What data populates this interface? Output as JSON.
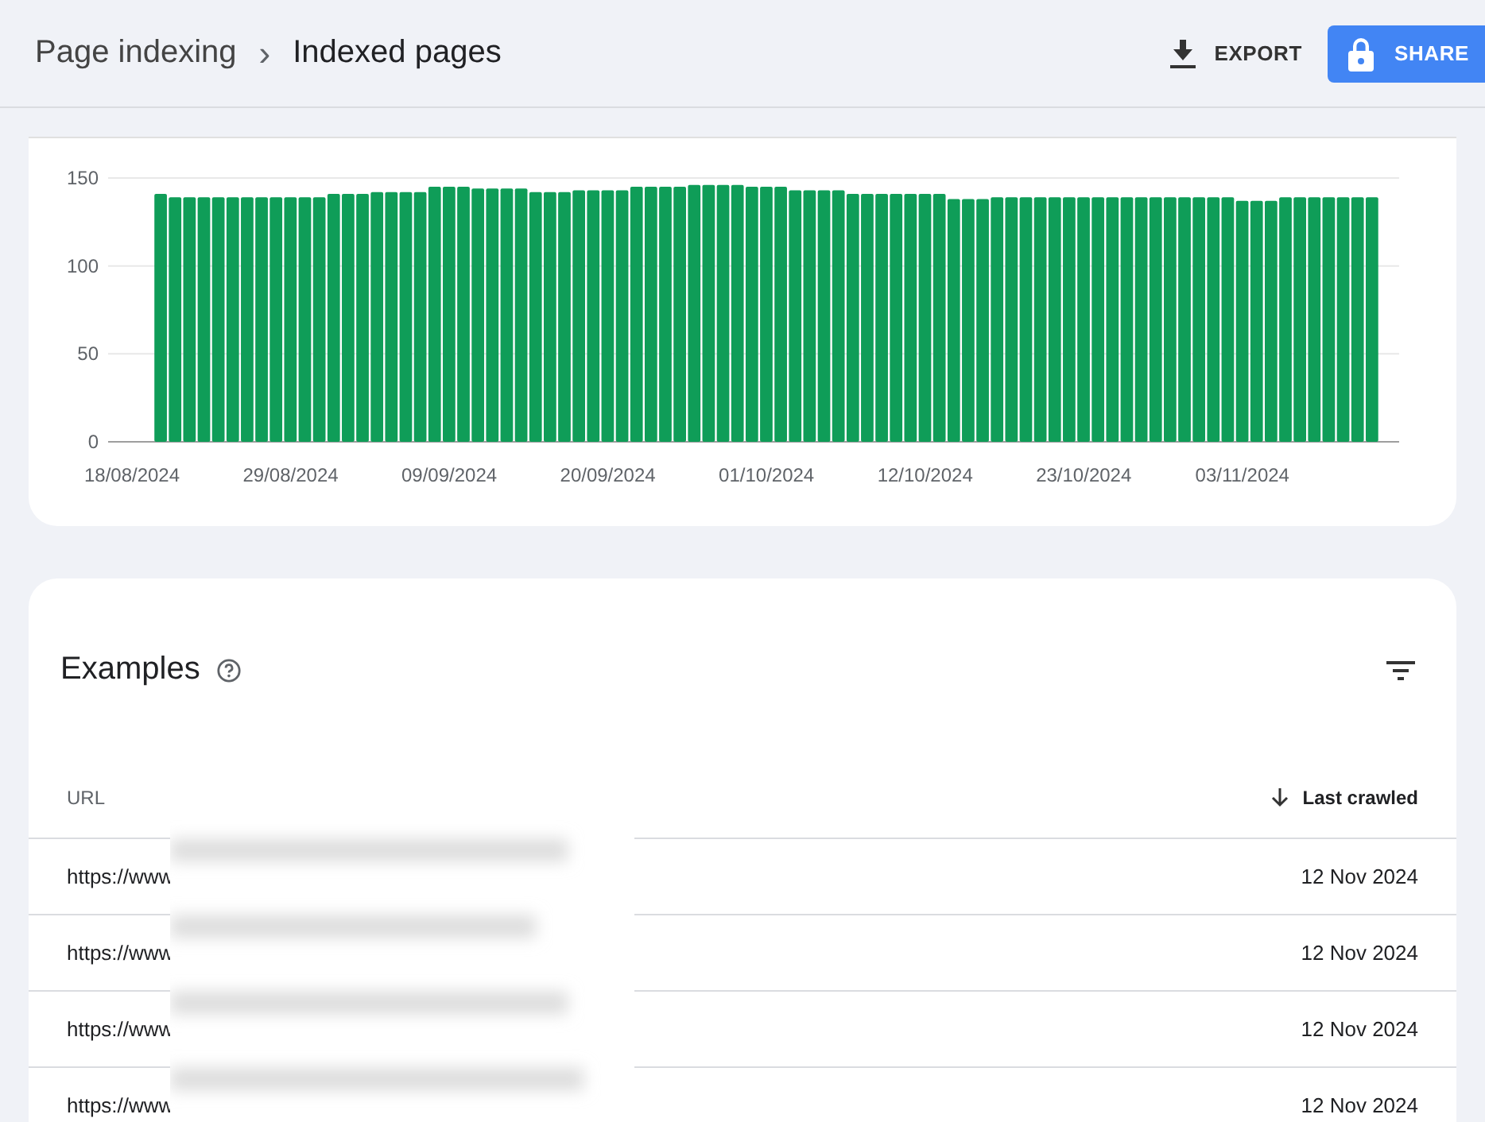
{
  "breadcrumb": {
    "parent": "Page indexing",
    "separator": "›",
    "current": "Indexed pages"
  },
  "actions": [
    {
      "kind": "export",
      "label": "EXPORT"
    },
    {
      "kind": "share",
      "label": "SHARE"
    }
  ],
  "chart": {
    "chart_data": {
      "type": "bar",
      "ylim": [
        0,
        150
      ],
      "yticks": [
        0,
        50,
        100,
        150
      ],
      "categories": [
        "18/08/2024",
        null,
        null,
        null,
        null,
        null,
        null,
        null,
        null,
        null,
        null,
        "29/08/2024",
        null,
        null,
        null,
        null,
        null,
        null,
        null,
        null,
        null,
        null,
        "09/09/2024",
        null,
        null,
        null,
        null,
        null,
        null,
        null,
        null,
        null,
        null,
        "20/09/2024",
        null,
        null,
        null,
        null,
        null,
        null,
        null,
        null,
        null,
        null,
        "01/10/2024",
        null,
        null,
        null,
        null,
        null,
        null,
        null,
        null,
        null,
        null,
        "12/10/2024",
        null,
        null,
        null,
        null,
        null,
        null,
        null,
        null,
        null,
        null,
        "23/10/2024",
        null,
        null,
        null,
        null,
        null,
        null,
        null,
        null,
        null,
        null,
        "03/11/2024",
        null,
        null,
        null,
        null,
        null,
        null,
        null,
        null,
        null
      ],
      "series": [
        {
          "color": "#0f9d58",
          "values": [
            null,
            null,
            141,
            139,
            139,
            139,
            139,
            139,
            139,
            139,
            139,
            139,
            139,
            139,
            141,
            141,
            141,
            142,
            142,
            142,
            142,
            145,
            145,
            145,
            144,
            144,
            144,
            144,
            142,
            142,
            142,
            143,
            143,
            143,
            143,
            145,
            145,
            145,
            145,
            146,
            146,
            146,
            146,
            145,
            145,
            145,
            143,
            143,
            143,
            143,
            141,
            141,
            141,
            141,
            141,
            141,
            141,
            138,
            138,
            138,
            139,
            139,
            139,
            139,
            139,
            139,
            139,
            139,
            139,
            139,
            139,
            139,
            139,
            139,
            139,
            139,
            139,
            137,
            137,
            137,
            139,
            139,
            139,
            139,
            139,
            139,
            139
          ]
        }
      ]
    }
  },
  "examples": {
    "title": "Examples",
    "columns": [
      {
        "label": "URL",
        "sorted": false
      },
      {
        "label": "Last crawled",
        "sorted": true
      }
    ],
    "rows": [
      {
        "url": "https://www",
        "last_crawled": "12 Nov 2024"
      },
      {
        "url": "https://www",
        "last_crawled": "12 Nov 2024"
      },
      {
        "url": "https://www",
        "last_crawled": "12 Nov 2024"
      },
      {
        "url": "https://www",
        "last_crawled": "12 Nov 2024"
      }
    ]
  }
}
